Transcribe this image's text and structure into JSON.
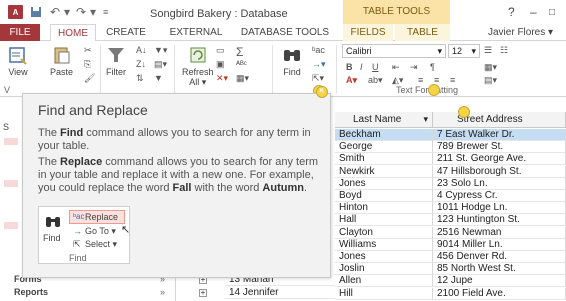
{
  "titlebar": {
    "app_logo": "A",
    "title": "Songbird Bakery : Database",
    "tools_label": "TABLE TOOLS",
    "help": "?",
    "minimize": "–",
    "restore": "□"
  },
  "tabs": [
    {
      "label": "FILE"
    },
    {
      "label": "HOME"
    },
    {
      "label": "CREATE"
    },
    {
      "label": "EXTERNAL DATA"
    },
    {
      "label": "DATABASE TOOLS"
    },
    {
      "label": "FIELDS"
    },
    {
      "label": "TABLE"
    }
  ],
  "account": "Javier Flores ▾",
  "ribbon": {
    "view": "View",
    "paste": "Paste",
    "filter": "Filter",
    "refresh_all": "Refresh\nAll ▾",
    "find": "Find",
    "font_name": "Calibri",
    "font_size": "12",
    "text_formatting": "Text Formatting",
    "clipboard_short": "V"
  },
  "nav": {
    "groups": [
      "Forms",
      "Reports"
    ],
    "first_letter": "S"
  },
  "table": {
    "headers": [
      "Last Name",
      "Street Address"
    ],
    "rows": [
      {
        "last": "Beckham",
        "addr": "7 East Walker Dr."
      },
      {
        "last": "George",
        "addr": "789 Brewer St."
      },
      {
        "last": "Smith",
        "addr": "211 St. George Ave."
      },
      {
        "last": "Newkirk",
        "addr": "47 Hillsborough St."
      },
      {
        "last": "Jones",
        "addr": "23 Solo Ln."
      },
      {
        "last": "Boyd",
        "addr": "4 Cypress Cr."
      },
      {
        "last": "Hinton",
        "addr": "1011 Hodge Ln."
      },
      {
        "last": "Hall",
        "addr": "123 Huntington St."
      },
      {
        "last": "Clayton",
        "addr": "2516 Newman"
      },
      {
        "last": "Williams",
        "addr": "9014 Miller Ln."
      },
      {
        "last": "Jones",
        "addr": "456 Denver Rd."
      },
      {
        "last": "Joslin",
        "addr": "85 North West St."
      },
      {
        "last": "Allen",
        "addr": "12 Jupe"
      },
      {
        "last": "Hill",
        "addr": "2100 Field Ave."
      }
    ],
    "id_rows": [
      {
        "id": "13",
        "first": "Mariah"
      },
      {
        "id": "14",
        "first": "Jennifer"
      }
    ]
  },
  "tooltip": {
    "title": "Find and Replace",
    "p1_pre": "The ",
    "p1_bold": "Find",
    "p1_post": " command allows you to search for any term in your table.",
    "p2_pre": "The ",
    "p2_bold": "Replace",
    "p2_mid": " command allows you to search for any term in your table and replace it with a new one. For example, you could replace the word ",
    "p2_bold2": "Fall",
    "p2_mid2": " with the word ",
    "p2_bold3": "Autumn",
    "p2_end": ".",
    "mini": {
      "replace": "Replace",
      "goto": "Go To ▾",
      "select": "Select ▾",
      "find": "Find",
      "group": "Find"
    }
  }
}
